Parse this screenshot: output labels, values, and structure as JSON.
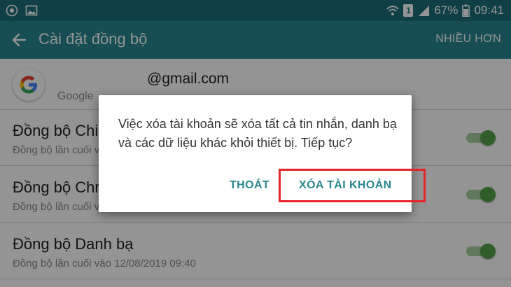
{
  "status_bar": {
    "battery": "67%",
    "time": "09:41",
    "sim_slot": "1",
    "icons": [
      "whatsapp-icon",
      "image-icon",
      "wifi-icon",
      "sim-icon",
      "signal-icon",
      "battery-icon"
    ]
  },
  "app_bar": {
    "title": "Cài đặt đồng bộ",
    "more_label": "NHIỀU HƠN"
  },
  "account": {
    "email": "@gmail.com",
    "provider": "Google"
  },
  "sync_items": [
    {
      "title": "Đồng bộ Chi t",
      "subtitle": "Đồng bộ lần cuối v"
    },
    {
      "title": "Đồng bộ Chro",
      "subtitle": "Đồng bộ lần cuối v"
    },
    {
      "title": "Đồng bộ Danh bạ",
      "subtitle": "Đồng bộ lần cuối vào 12/08/2019 09:40"
    }
  ],
  "dialog": {
    "message": "Việc xóa tài khoản sẽ xóa tất cả tin nhắn, danh bạ và các dữ liệu khác khỏi thiết bị. Tiếp tục?",
    "cancel_label": "THOÁT",
    "confirm_label": "XÓA TÀI KHOẢN"
  },
  "colors": {
    "status_bar": "#1d6f79",
    "app_bar": "#29878f",
    "toggle_on": "#55a14a",
    "highlight": "#e32529"
  }
}
